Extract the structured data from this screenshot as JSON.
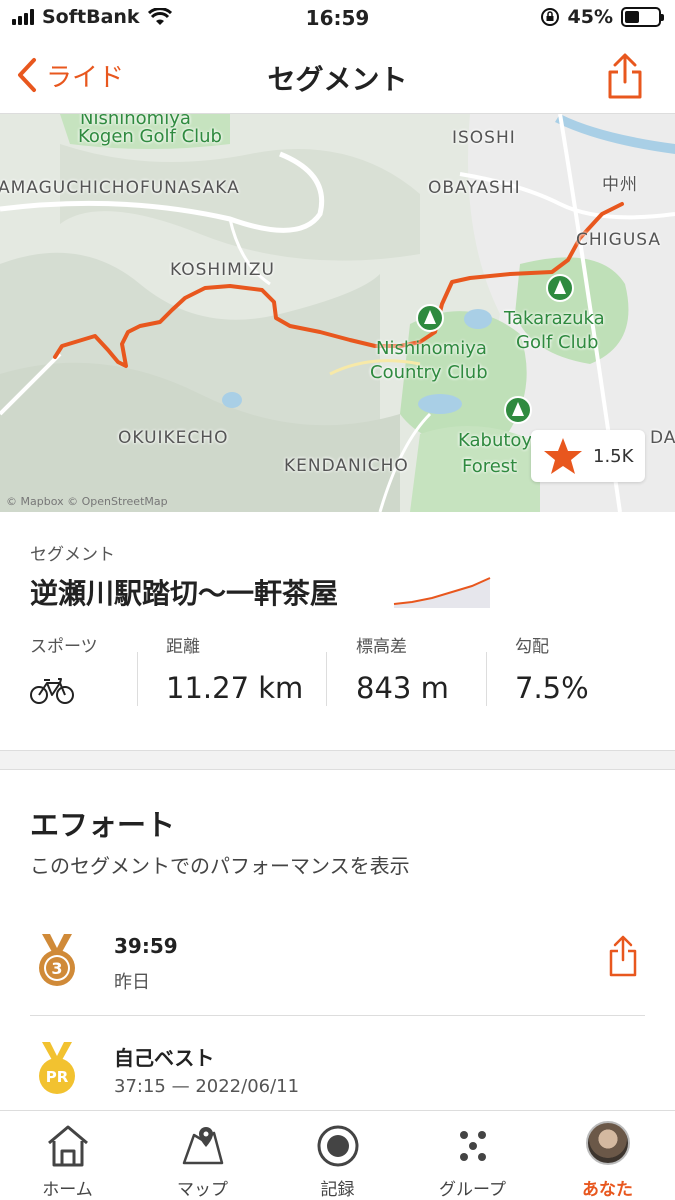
{
  "status_bar": {
    "carrier": "SoftBank",
    "time": "16:59",
    "battery": "45%",
    "battery_level": 0.45
  },
  "nav": {
    "back_label": "ライド",
    "title": "セグメント"
  },
  "map": {
    "labels": {
      "kogen_golf_line1": "Nishinomiya",
      "kogen_golf_line2": "Kogen Golf Club",
      "isoshi": "ISOSHI",
      "yamaguchi": "AMAGUCHICHOFUNASAKA",
      "obayashi": "OBAYASHI",
      "nakasu": "中州",
      "chigusa": "CHIGUSA",
      "koshimizu": "KOSHIMIZU",
      "takarazuka_line1": "Takarazuka",
      "takarazuka_line2": "Golf Club",
      "nishinomiya_cc_line1": "Nishinomiya",
      "nishinomiya_cc_line2": "Country Club",
      "kabuto_line1": "Kabutoy",
      "kabuto_line2": "Forest",
      "okuikecho": "OKUIKECHO",
      "kendanicho": "KENDANICHO",
      "da": "DA"
    },
    "attribution": "© Mapbox © OpenStreetMap",
    "star_count": "1.5K"
  },
  "segment": {
    "kicker": "セグメント",
    "name": "逆瀬川駅踏切〜一軒茶屋",
    "stats": {
      "sport_label": "スポーツ",
      "distance_label": "距離",
      "distance_value": "11.27 km",
      "elevation_label": "標高差",
      "elevation_value": "843 m",
      "grade_label": "勾配",
      "grade_value": "7.5%"
    }
  },
  "efforts": {
    "title": "エフォート",
    "subtitle": "このセグメントでのパフォーマンスを表示",
    "rows": [
      {
        "time": "39:59",
        "date": "昨日",
        "medal": "3"
      },
      {
        "time": "自己ベスト",
        "date": "37:15 — 2022/06/11",
        "medal": "PR"
      }
    ]
  },
  "tabs": [
    {
      "label": "ホーム",
      "icon": "home-icon"
    },
    {
      "label": "マップ",
      "icon": "map-icon"
    },
    {
      "label": "記録",
      "icon": "record-icon"
    },
    {
      "label": "グループ",
      "icon": "group-icon"
    },
    {
      "label": "あなた",
      "icon": "avatar",
      "active": true
    }
  ],
  "colors": {
    "accent": "#e8571e",
    "medal_bronze": "#d08a38",
    "medal_gold": "#f2c230",
    "park_green": "#2f8a3f"
  }
}
